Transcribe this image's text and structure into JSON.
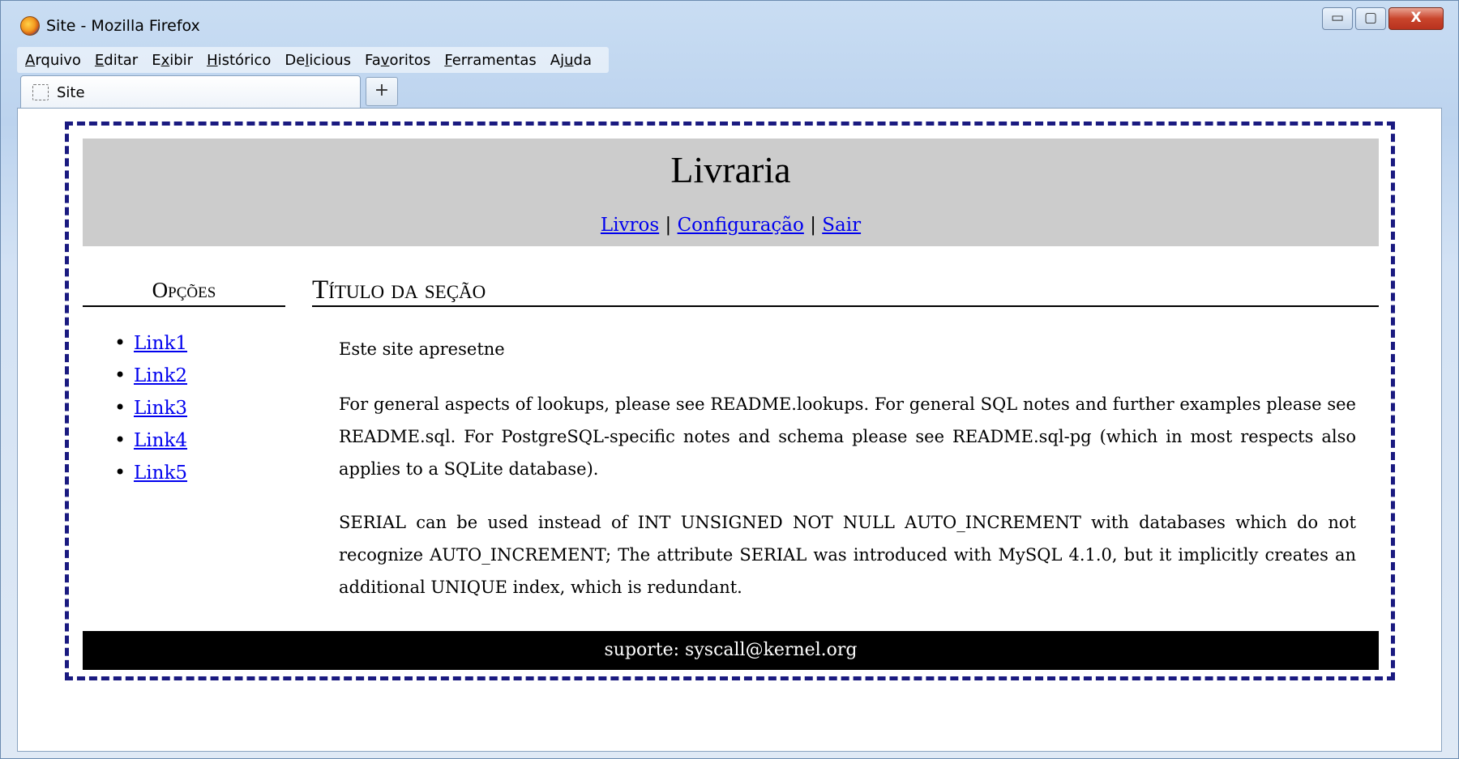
{
  "window": {
    "title": "Site - Mozilla Firefox",
    "buttons": {
      "minimize": "▭",
      "maximize": "▢",
      "close": "X"
    }
  },
  "menubar": {
    "items": [
      {
        "label": "Arquivo",
        "accel": "A"
      },
      {
        "label": "Editar",
        "accel": "E"
      },
      {
        "label": "Exibir",
        "accel": "x"
      },
      {
        "label": "Histórico",
        "accel": "H"
      },
      {
        "label": "Delicious",
        "accel": "l"
      },
      {
        "label": "Favoritos",
        "accel": "v"
      },
      {
        "label": "Ferramentas",
        "accel": "F"
      },
      {
        "label": "Ajuda",
        "accel": "u"
      }
    ]
  },
  "tabs": [
    {
      "label": "Site",
      "icon": "blank-page-icon"
    }
  ],
  "newtab": {
    "label": "+"
  },
  "page": {
    "site_title": "Livraria",
    "nav": {
      "links": [
        "Livros",
        "Configuração",
        "Sair"
      ],
      "separator": "|"
    },
    "sidebar": {
      "heading": "Opções",
      "links": [
        "Link1",
        "Link2",
        "Link3",
        "Link4",
        "Link5"
      ]
    },
    "main": {
      "heading": "Título da seção",
      "paragraphs": [
        "Este site apresetne",
        "For general aspects of lookups, please see README.lookups. For general SQL notes and further examples please see README.sql. For PostgreSQL-specific notes and schema please see README.sql-pg (which in most respects also applies to a SQLite database).",
        "SERIAL can be used instead of INT UNSIGNED NOT NULL AUTO_INCREMENT with databases which do not recognize AUTO_INCREMENT; The attribute SERIAL was introduced with MySQL 4.1.0, but it implicitly creates an additional UNIQUE index, which is redundant."
      ]
    },
    "footer": "suporte: syscall@kernel.org"
  },
  "colors": {
    "link": "#0000ee",
    "header_bg": "#cccccc",
    "footer_bg": "#000000",
    "page_border": "#1a1a80"
  }
}
